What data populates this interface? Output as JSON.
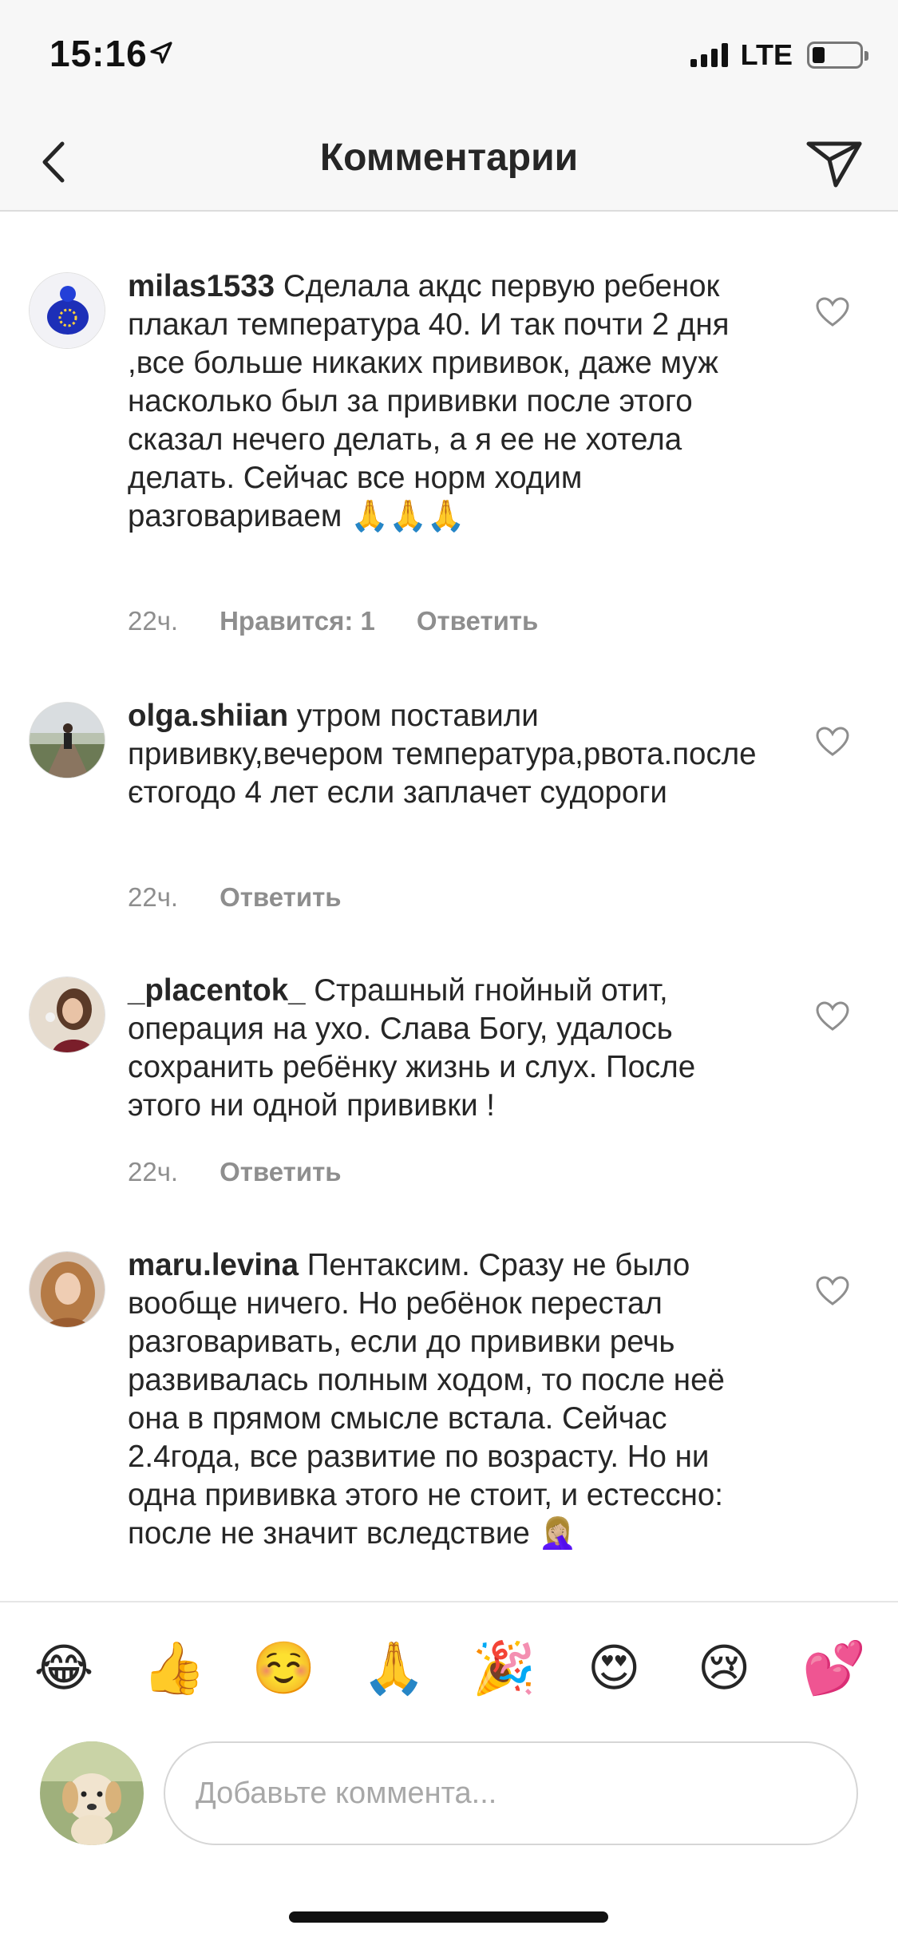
{
  "status": {
    "time": "15:16",
    "network": "LTE",
    "location_icon": "location-arrow-icon",
    "battery_level": 0.25
  },
  "header": {
    "title": "Комментарии",
    "back_icon": "chevron-left-icon",
    "share_icon": "paper-plane-icon"
  },
  "comments": [
    {
      "username": "milas1533",
      "text": "Сделала акдс первую ребенок плакал температура 40. И так почти 2 дня ,все больше никаких прививок, даже муж насколько был за прививки после этого сказал нечего делать,  а я ее не хотела делать. Сейчас все норм ходим разговариваем 🙏🙏🙏",
      "time": "22ч.",
      "likes": "Нравится: 1",
      "reply": "Ответить"
    },
    {
      "username": "olga.shiian",
      "text": "утром поставили прививку,вечером температура,рвота.после єтогодо 4 лет если заплачет судороги",
      "time": "22ч.",
      "reply": "Ответить"
    },
    {
      "username": "_placentok_",
      "text": "Страшный гнойный отит, операция на ухо. Слава Богу, удалось сохранить ребёнку жизнь и слух. После этого ни одной прививки !",
      "time": "22ч.",
      "reply": "Ответить"
    },
    {
      "username": "maru.levina",
      "text": "Пентаксим. Сразу не было вообще ничего. Но ребёнок перестал разговаривать, если до прививки речь развивалась полным ходом, то после неё она в прямом смысле встала. Сейчас 2.4года, все развитие по возрасту. Но ни одна прививка этого не стоит, и естессно: после не значит вследствие 🤦🏼‍♀️"
    }
  ],
  "emoji_bar": [
    "😂",
    "👍",
    "☺️",
    "🙏",
    "🎉",
    "😍",
    "😢",
    "💕"
  ],
  "composer": {
    "placeholder": "Добавьте коммента..."
  }
}
